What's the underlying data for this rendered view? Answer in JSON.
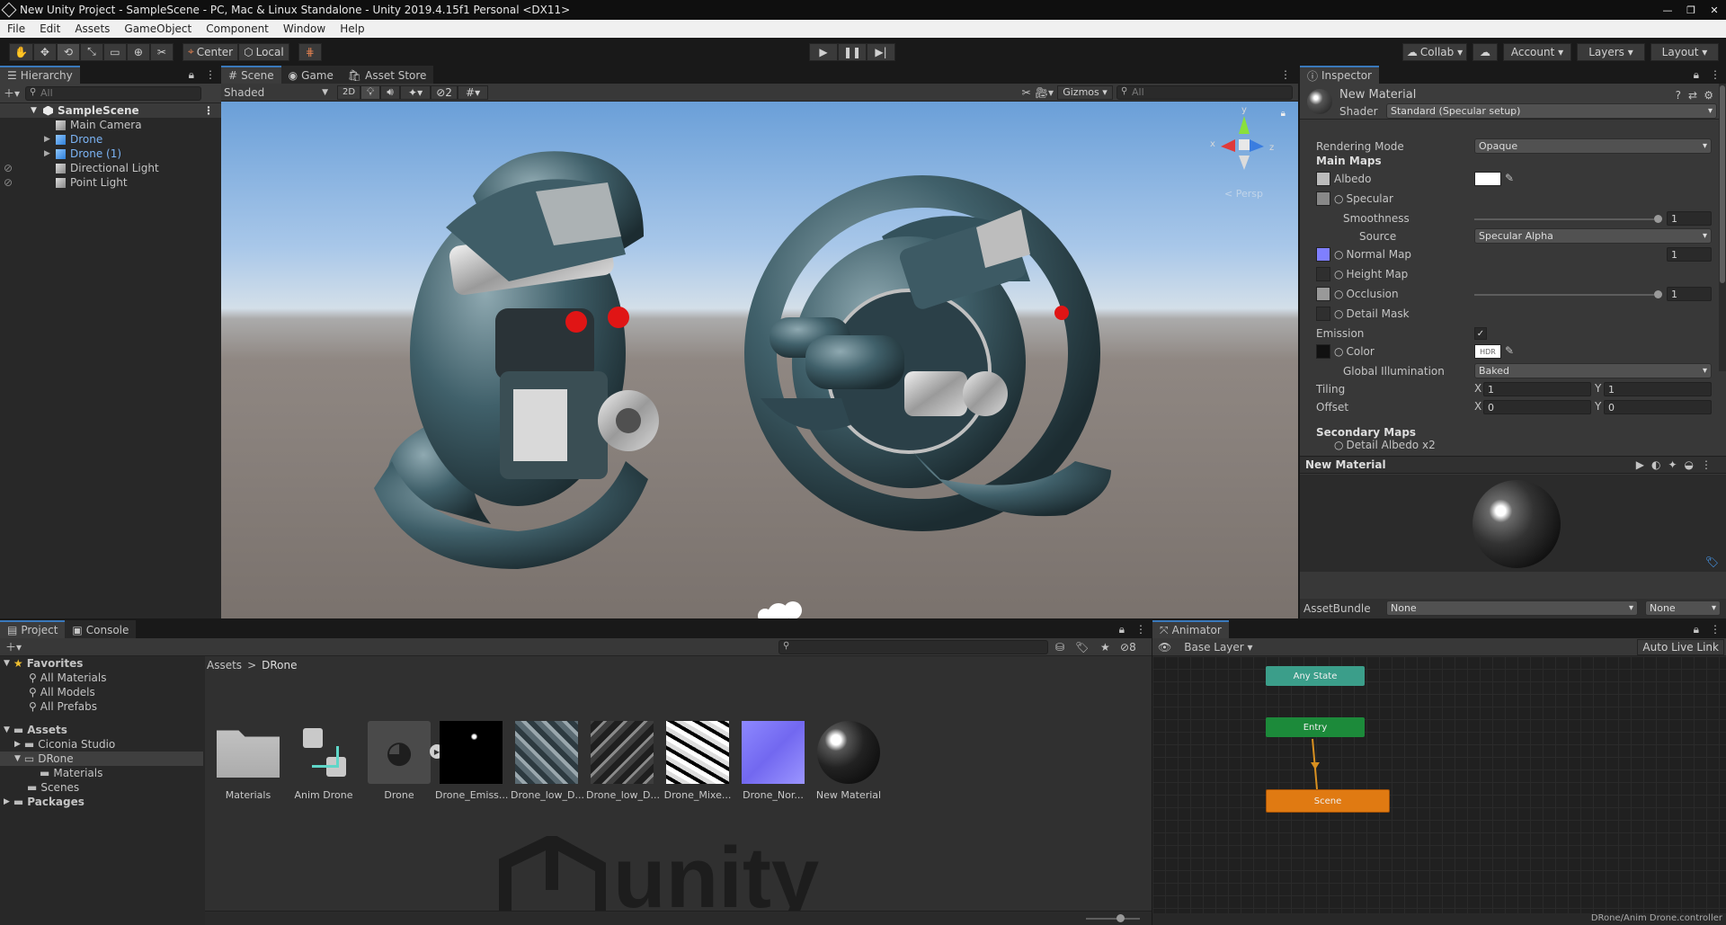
{
  "window": {
    "title": "New Unity Project - SampleScene - PC, Mac & Linux Standalone - Unity 2019.4.15f1 Personal <DX11>"
  },
  "menu": [
    "File",
    "Edit",
    "Assets",
    "GameObject",
    "Component",
    "Window",
    "Help"
  ],
  "toolbar": {
    "pivot": "Center",
    "space": "Local",
    "collab": "Collab",
    "account": "Account",
    "layers": "Layers",
    "layout": "Layout"
  },
  "hierarchy": {
    "tab": "Hierarchy",
    "search_placeholder": "All",
    "scene": "SampleScene",
    "items": [
      "Main Camera",
      "Drone",
      "Drone (1)",
      "Directional Light",
      "Point Light"
    ]
  },
  "scene": {
    "tabs": [
      "Scene",
      "Game",
      "Asset Store"
    ],
    "shading": "Shaded",
    "mode2d": "2D",
    "fx_count": "2",
    "gizmos": "Gizmos",
    "search_placeholder": "All",
    "gizmo_axes": {
      "x": "x",
      "y": "y",
      "z": "z"
    },
    "view_label": "< Persp"
  },
  "inspector": {
    "tab": "Inspector",
    "material_name": "New Material",
    "shader_label": "Shader",
    "shader": "Standard (Specular setup)",
    "rendering_mode_label": "Rendering Mode",
    "rendering_mode": "Opaque",
    "main_maps": "Main Maps",
    "albedo": "Albedo",
    "specular": "Specular",
    "smoothness_label": "Smoothness",
    "smoothness": "1",
    "source_label": "Source",
    "source": "Specular Alpha",
    "normal_map": "Normal Map",
    "normal_value": "1",
    "height_map": "Height Map",
    "occlusion": "Occlusion",
    "occlusion_value": "1",
    "detail_mask": "Detail Mask",
    "emission": "Emission",
    "color": "Color",
    "hdr": "HDR",
    "gi_label": "Global Illumination",
    "gi": "Baked",
    "tiling": "Tiling",
    "tiling_x": "1",
    "tiling_y": "1",
    "offset": "Offset",
    "offset_x": "0",
    "offset_y": "0",
    "x": "X",
    "y": "Y",
    "secondary_maps": "Secondary Maps",
    "detail_albedo": "Detail Albedo x2",
    "preview_title": "New Material",
    "assetbundle_label": "AssetBundle",
    "assetbundle": "None",
    "assetbundle_variant": "None"
  },
  "project": {
    "tabs": [
      "Project",
      "Console"
    ],
    "favorites": "Favorites",
    "fav_items": [
      "All Materials",
      "All Models",
      "All Prefabs"
    ],
    "assets": "Assets",
    "tree": [
      "Ciconia Studio",
      "DRone",
      "Materials",
      "Scenes"
    ],
    "packages": "Packages",
    "breadcrumb": [
      "Assets",
      "DRone"
    ],
    "hidden_count": "8",
    "items": [
      "Materials",
      "Anim Drone",
      "Drone",
      "Drone_Emiss...",
      "Drone_low_D...",
      "Drone_low_D...",
      "Drone_Mixe...",
      "Drone_Nor...",
      "New Material"
    ],
    "watermark": "unity"
  },
  "animator": {
    "tab": "Animator",
    "layer": "Base Layer",
    "auto_live": "Auto Live Link",
    "nodes": {
      "any": "Any State",
      "entry": "Entry",
      "scene": "Scene"
    },
    "footer": "DRone/Anim Drone.controller"
  },
  "colors": {
    "accent": "#3a79bb",
    "entry": "#1c8a3a",
    "state": "#e07a12",
    "any": "#3b9e8a"
  }
}
